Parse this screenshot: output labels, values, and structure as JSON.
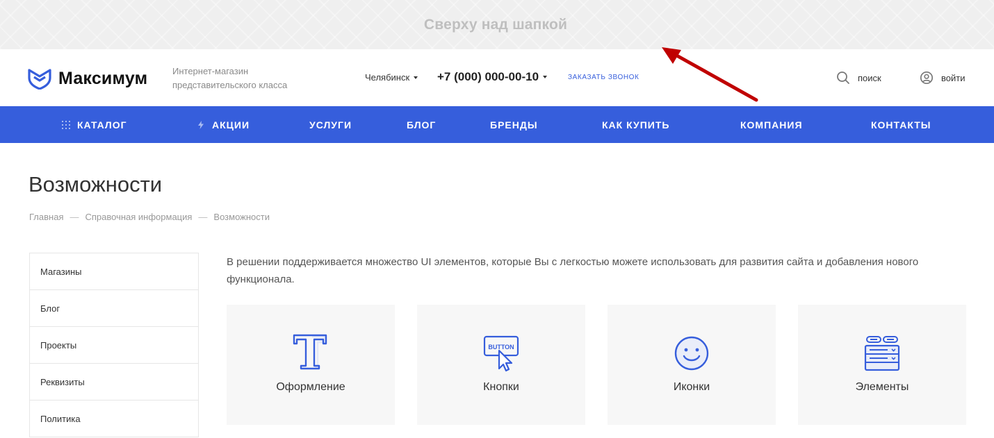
{
  "banner": {
    "text": "Сверху над шапкой"
  },
  "header": {
    "logo_text": "Максимум",
    "tagline": "Интернет-магазин представительского класса",
    "city": "Челябинск",
    "phone": "+7 (000) 000-00-10",
    "callback_label": "ЗАКАЗАТЬ ЗВОНОК",
    "search_label": "поиск",
    "login_label": "войти"
  },
  "nav": {
    "items": [
      {
        "label": "КАТАЛОГ",
        "icon": "grid-icon"
      },
      {
        "label": "АКЦИИ",
        "icon": "lightning-icon"
      },
      {
        "label": "УСЛУГИ"
      },
      {
        "label": "БЛОГ"
      },
      {
        "label": "БРЕНДЫ"
      },
      {
        "label": "КАК КУПИТЬ"
      },
      {
        "label": "КОМПАНИЯ"
      },
      {
        "label": "КОНТАКТЫ"
      }
    ]
  },
  "page": {
    "title": "Возможности",
    "breadcrumbs": [
      "Главная",
      "Справочная информация",
      "Возможности"
    ],
    "breadcrumb_sep": "—"
  },
  "sidebar": {
    "items": [
      {
        "label": "Магазины"
      },
      {
        "label": "Блог"
      },
      {
        "label": "Проекты"
      },
      {
        "label": "Реквизиты"
      },
      {
        "label": "Политика"
      }
    ]
  },
  "main": {
    "intro": "В решении поддерживается множество UI элементов, которые Вы с легкостью можете использовать для развития сайта и добавления нового функционала.",
    "cards": [
      {
        "label": "Оформление",
        "icon": "typography-icon"
      },
      {
        "label": "Кнопки",
        "icon": "button-cursor-icon",
        "icon_text": "BUTTON"
      },
      {
        "label": "Иконки",
        "icon": "smiley-icon"
      },
      {
        "label": "Элементы",
        "icon": "form-elements-icon"
      }
    ]
  },
  "colors": {
    "accent": "#365edc",
    "arrow": "#c00000",
    "banner_bg": "#efefef",
    "card_bg": "#f7f7f7"
  }
}
